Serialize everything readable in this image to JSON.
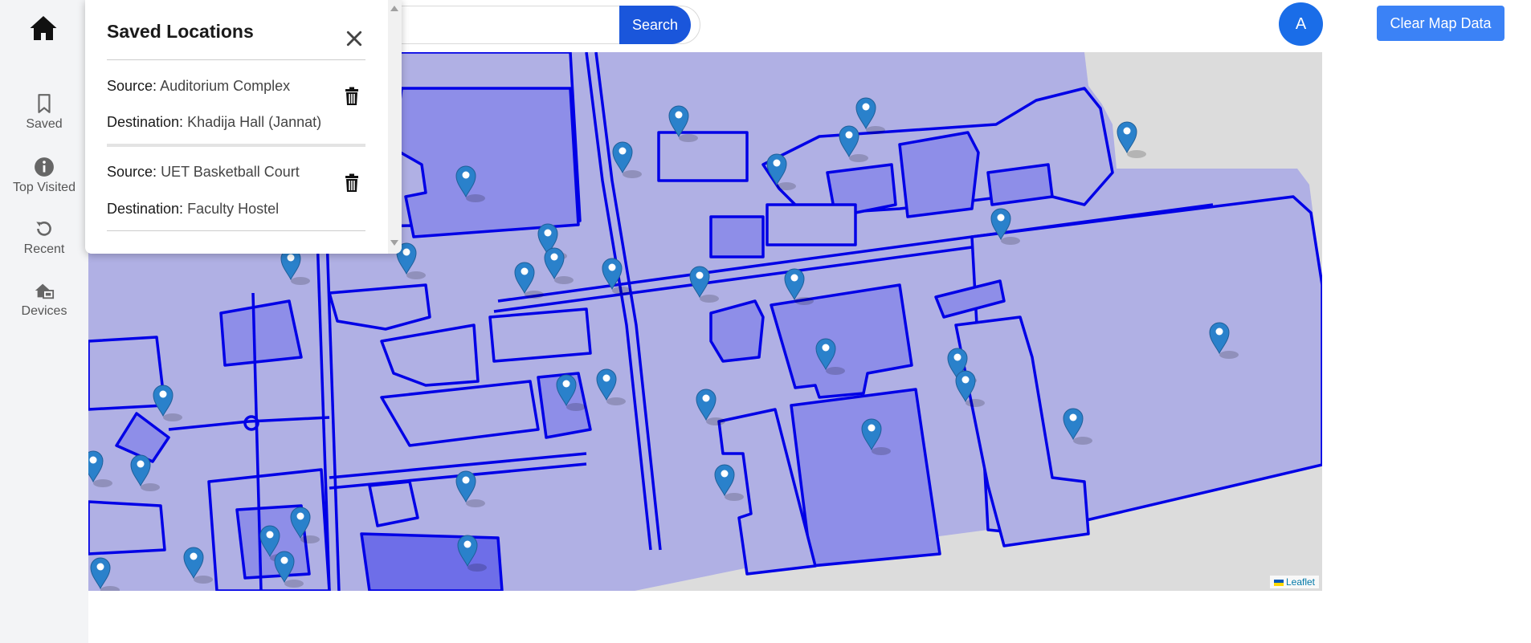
{
  "sidebar": {
    "home_icon": "home-icon",
    "items": [
      {
        "label": "Saved",
        "icon": "bookmark-icon"
      },
      {
        "label": "Top Visited",
        "icon": "info-icon"
      },
      {
        "label": "Recent",
        "icon": "history-icon"
      },
      {
        "label": "Devices",
        "icon": "devices-icon"
      }
    ]
  },
  "header": {
    "search_value": "",
    "search_button": "Search",
    "avatar_initial": "A",
    "clear_button": "Clear Map Data"
  },
  "saved_panel": {
    "title": "Saved Locations",
    "source_key": "Source:",
    "destination_key": "Destination:",
    "entries": [
      {
        "source": "Auditorium Complex",
        "destination": "Khadija Hall (Jannat)"
      },
      {
        "source": "UET Basketball Court",
        "destination": "Faculty Hostel"
      }
    ]
  },
  "map": {
    "attribution": "Leaflet",
    "marker_count": 37,
    "colors": {
      "background": "#dcdcdc",
      "polygon_fill": "#b0b0e4",
      "building_fill": "#8e8ee8",
      "outline": "#0000e6",
      "marker": "#2a81cb",
      "accent": "#1a56db"
    }
  }
}
